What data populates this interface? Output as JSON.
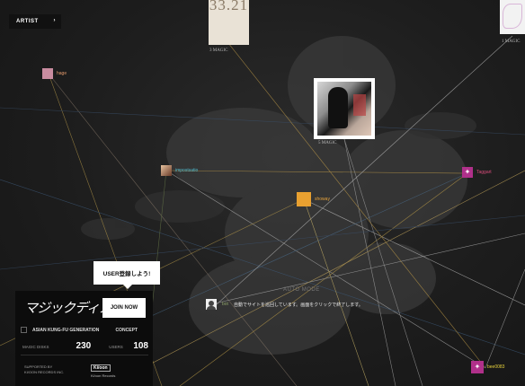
{
  "nav": {
    "artist_label": "ARTIST"
  },
  "covers": {
    "top_center": {
      "title_text": "33.21",
      "caption": "3 MAGIC"
    },
    "top_right": {
      "caption": "1 MAGIC"
    },
    "main": {
      "caption": "5 MAGIC"
    }
  },
  "users": [
    {
      "name": "hage",
      "color": "#e49a6b"
    },
    {
      "name": "impostsatio",
      "color": "#4fb7c9"
    },
    {
      "name": "showay",
      "color": "#e6a33c"
    },
    {
      "name": "Taggart",
      "color": "#d94b7b"
    },
    {
      "name": "bee0083",
      "color": "#e6d13c"
    }
  ],
  "auto_mode": {
    "label": "AUTO MODE",
    "user_name": "bot",
    "message": "自動でサイトを巡回しています。画面をクリックで終了します。"
  },
  "signup_bubble": "USER登録しよう!",
  "panel": {
    "logo_text": "マジックディスク",
    "join_label": "JOIN NOW",
    "band": "ASIAN KUNG-FU GENERATION",
    "concept": "CONCEPT",
    "magic_discs_label": "MAGIC DISKS",
    "magic_discs_value": "230",
    "users_label": "USERS",
    "users_value": "108",
    "supported_by_line1": "SUPPORTED BY",
    "supported_by_line2": "KI/OON RECORDS INC.",
    "label_logo": "Ki/oon",
    "label_name": "Ki/oon Records"
  },
  "colors": {
    "background": "#1c1c1c",
    "panel": "#0c0c0c",
    "accent": "#ffffff"
  }
}
